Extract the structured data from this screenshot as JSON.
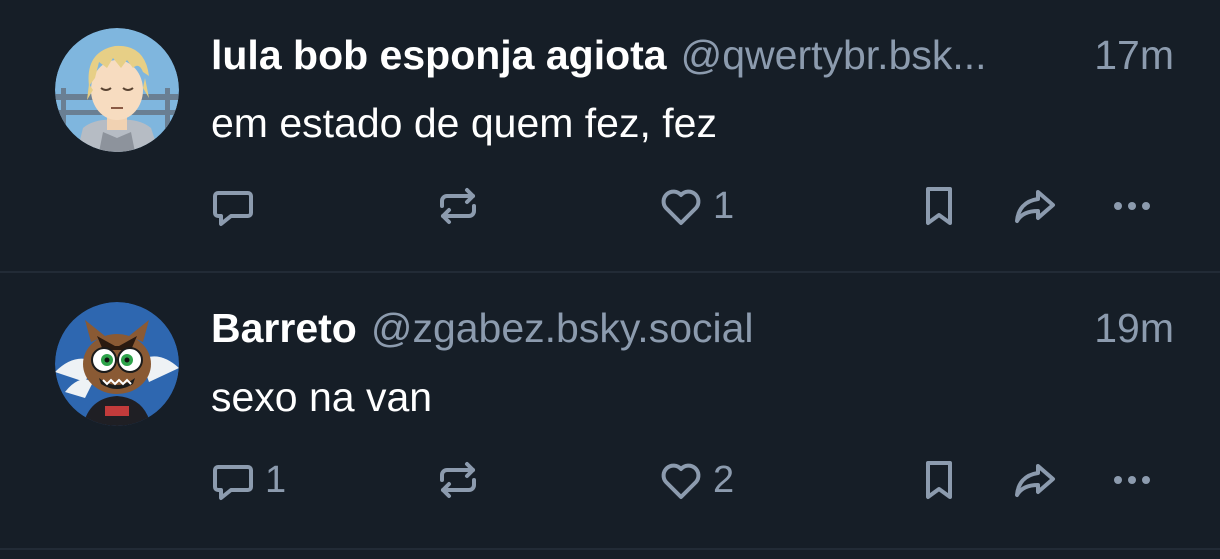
{
  "posts": [
    {
      "display_name": "lula bob esponja agiota",
      "handle": "@qwertybr.bsk...",
      "timestamp": "17m",
      "text": "em estado de quem fez, fez",
      "reply_count": "",
      "repost_count": "",
      "like_count": "1"
    },
    {
      "display_name": "Barreto",
      "handle": "@zgabez.bsky.social",
      "timestamp": "19m",
      "text": "sexo na van",
      "reply_count": "1",
      "repost_count": "",
      "like_count": "2"
    }
  ],
  "icons": {
    "reply": "reply-icon",
    "repost": "repost-icon",
    "like": "heart-icon",
    "bookmark": "bookmark-icon",
    "share": "share-icon",
    "more": "more-options-icon"
  },
  "colors": {
    "background": "#161e27",
    "muted_text": "#8c9bae",
    "divider": "#222b36"
  }
}
